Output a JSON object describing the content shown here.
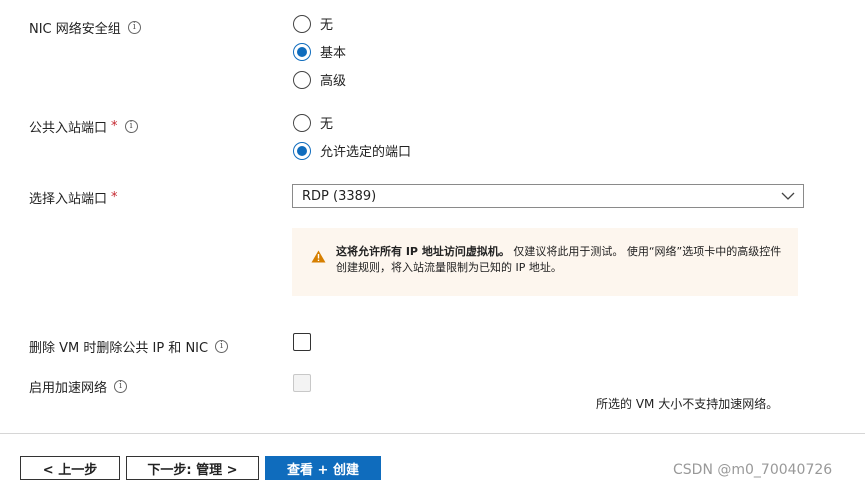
{
  "nic_security_group": {
    "label": "NIC 网络安全组",
    "info_icon": "i",
    "options": [
      {
        "label": "无",
        "selected": false
      },
      {
        "label": "基本",
        "selected": true
      },
      {
        "label": "高级",
        "selected": false
      }
    ]
  },
  "public_inbound_ports": {
    "label": "公共入站端口",
    "required_mark": "*",
    "info_icon": "i",
    "options": [
      {
        "label": "无",
        "selected": false
      },
      {
        "label": "允许选定的端口",
        "selected": true
      }
    ]
  },
  "select_inbound_ports": {
    "label": "选择入站端口",
    "required_mark": "*",
    "value": "RDP (3389)"
  },
  "warning": {
    "bold_text": "这将允许所有 IP 地址访问虚拟机。",
    "text": "仅建议将此用于测试。 使用“网络”选项卡中的高级控件创建规则，将入站流量限制为已知的 IP 地址。",
    "color": "#d67f00"
  },
  "delete_public_ip": {
    "label": "删除 VM 时删除公共 IP 和 NIC",
    "info_icon": "i",
    "checked": false
  },
  "accelerated_networking": {
    "label": "启用加速网络",
    "info_icon": "i",
    "checked": false,
    "disabled": true,
    "note": "所选的 VM 大小不支持加速网络。"
  },
  "footer": {
    "prev_label": "< 上一步",
    "next_label": "下一步: 管理 >",
    "review_label": "查看 + 创建"
  },
  "watermark": "CSDN @m0_70040726",
  "colors": {
    "accent": "#0f6cbd",
    "required": "#c4262e",
    "warning_bg": "#fdf6ee"
  }
}
